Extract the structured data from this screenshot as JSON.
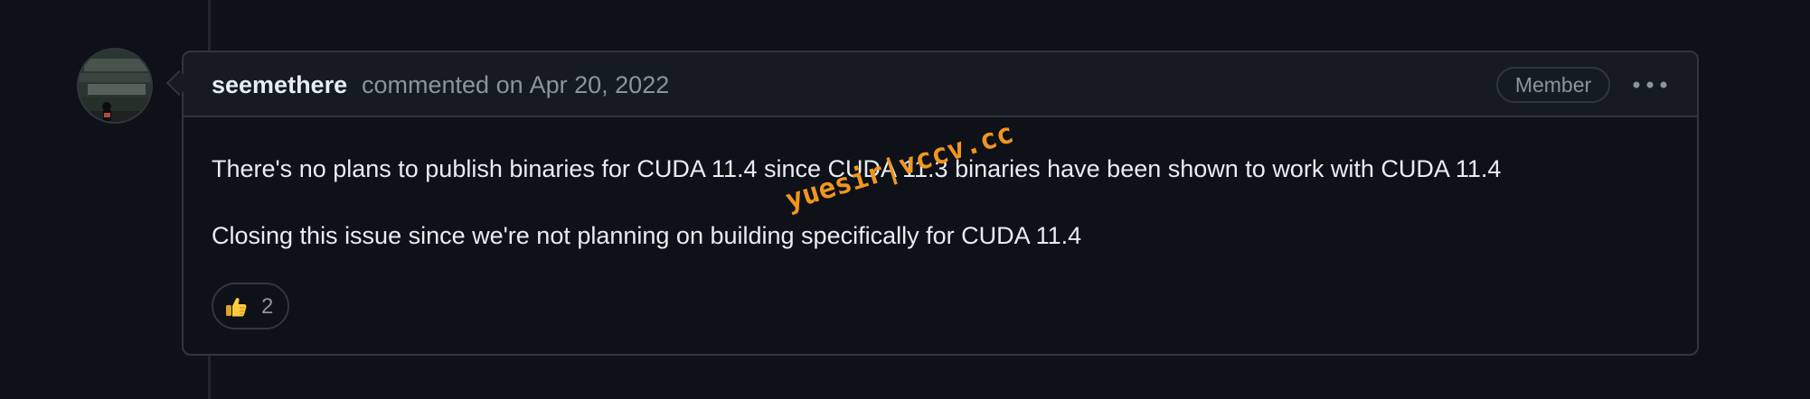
{
  "comment": {
    "author": "seemethere",
    "action": "commented on",
    "timestamp": "Apr 20, 2022",
    "role_badge": "Member",
    "menu_icon": "kebab-horizontal-icon",
    "body": [
      "There's no plans to publish binaries for CUDA 11.4 since CUDA 11.3 binaries have been shown to work with CUDA 11.4",
      "Closing this issue since we're not planning on building specifically for CUDA 11.4"
    ],
    "reactions": [
      {
        "emoji": "thumbs-up-icon",
        "count": "2"
      }
    ]
  },
  "watermark": "yuesir|vccv.cc",
  "colors": {
    "background": "#0e1117",
    "header_background": "#161b22",
    "border": "#30363d",
    "text_primary": "#e6edf3",
    "text_muted": "#8b949e",
    "watermark": "#f0961e"
  }
}
